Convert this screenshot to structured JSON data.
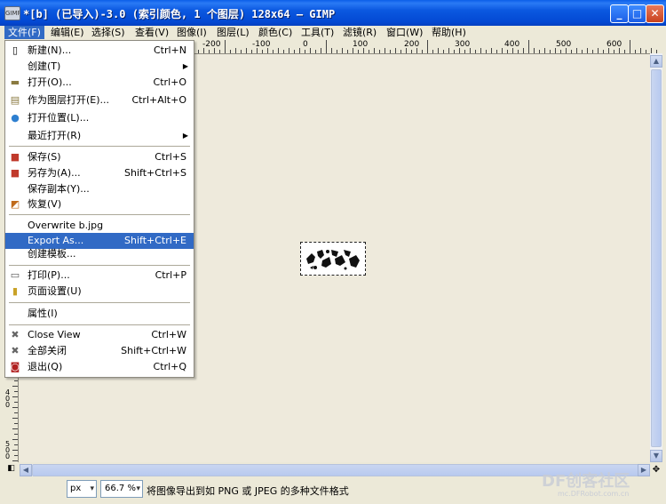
{
  "window": {
    "title": "*[b] (已导入)-3.0 (索引颜色, 1 个图层) 128x64 – GIMP",
    "icon_label": "GIMP",
    "minimize_icon": "minimize-icon",
    "maximize_icon": "maximize-icon",
    "close_icon": "close-icon"
  },
  "menubar": [
    {
      "label": "文件(F)"
    },
    {
      "label": "编辑(E)"
    },
    {
      "label": "选择(S)"
    },
    {
      "label": "查看(V)"
    },
    {
      "label": "图像(I)"
    },
    {
      "label": "图层(L)"
    },
    {
      "label": "颜色(C)"
    },
    {
      "label": "工具(T)"
    },
    {
      "label": "滤镜(R)"
    },
    {
      "label": "窗口(W)"
    },
    {
      "label": "帮助(H)"
    }
  ],
  "ruler": {
    "top_labels": [
      "-200",
      "-100",
      "0",
      "100",
      "200",
      "300",
      "400",
      "500",
      "600"
    ],
    "left_labels": [
      "400",
      "500"
    ]
  },
  "file_menu": {
    "items": [
      {
        "label": "新建(N)...",
        "shortcut": "Ctrl+N",
        "icon": "new-file-icon"
      },
      {
        "label": "创建(T)",
        "submenu": true
      },
      {
        "label": "打开(O)...",
        "shortcut": "Ctrl+O",
        "icon": "open-folder-icon"
      },
      {
        "label": "作为图层打开(E)...",
        "shortcut": "Ctrl+Alt+O",
        "icon": "open-as-layer-icon"
      },
      {
        "label": "打开位置(L)...",
        "icon": "globe-icon"
      },
      {
        "label": "最近打开(R)",
        "submenu": true
      },
      {
        "label": "保存(S)",
        "shortcut": "Ctrl+S",
        "icon": "save-icon"
      },
      {
        "label": "另存为(A)...",
        "shortcut": "Shift+Ctrl+S",
        "icon": "save-as-icon"
      },
      {
        "label": "保存副本(Y)..."
      },
      {
        "label": "恢复(V)",
        "icon": "revert-icon"
      },
      {
        "label": "Overwrite b.jpg"
      },
      {
        "label": "Export As...",
        "shortcut": "Shift+Ctrl+E",
        "highlighted": true
      },
      {
        "label": "创建模板..."
      },
      {
        "label": "打印(P)...",
        "shortcut": "Ctrl+P",
        "icon": "print-icon"
      },
      {
        "label": "页面设置(U)",
        "icon": "page-setup-icon"
      },
      {
        "label": "属性(I)"
      },
      {
        "label": "Close View",
        "shortcut": "Ctrl+W",
        "icon": "close-view-icon"
      },
      {
        "label": "全部关闭",
        "shortcut": "Shift+Ctrl+W",
        "icon": "close-all-icon"
      },
      {
        "label": "退出(Q)",
        "shortcut": "Ctrl+Q",
        "icon": "quit-icon"
      }
    ]
  },
  "statusbar": {
    "unit": "px",
    "zoom": "66.7 %",
    "message": "将图像导出到如 PNG 或 JPEG 的多种文件格式",
    "watermark": "DF创客社区",
    "watermark_url": "mc.DFRobot.com.cn"
  },
  "colors": {
    "titlebar": "#0349d3",
    "highlight": "#316ac5",
    "canvas": "#eeeadc"
  }
}
